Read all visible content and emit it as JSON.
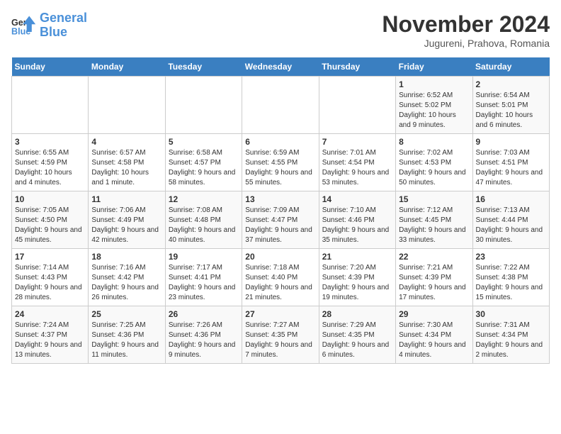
{
  "logo": {
    "line1": "General",
    "line2": "Blue"
  },
  "title": "November 2024",
  "subtitle": "Jugureni, Prahova, Romania",
  "days_of_week": [
    "Sunday",
    "Monday",
    "Tuesday",
    "Wednesday",
    "Thursday",
    "Friday",
    "Saturday"
  ],
  "weeks": [
    [
      {
        "day": "",
        "info": ""
      },
      {
        "day": "",
        "info": ""
      },
      {
        "day": "",
        "info": ""
      },
      {
        "day": "",
        "info": ""
      },
      {
        "day": "",
        "info": ""
      },
      {
        "day": "1",
        "info": "Sunrise: 6:52 AM\nSunset: 5:02 PM\nDaylight: 10 hours and 9 minutes."
      },
      {
        "day": "2",
        "info": "Sunrise: 6:54 AM\nSunset: 5:01 PM\nDaylight: 10 hours and 6 minutes."
      }
    ],
    [
      {
        "day": "3",
        "info": "Sunrise: 6:55 AM\nSunset: 4:59 PM\nDaylight: 10 hours and 4 minutes."
      },
      {
        "day": "4",
        "info": "Sunrise: 6:57 AM\nSunset: 4:58 PM\nDaylight: 10 hours and 1 minute."
      },
      {
        "day": "5",
        "info": "Sunrise: 6:58 AM\nSunset: 4:57 PM\nDaylight: 9 hours and 58 minutes."
      },
      {
        "day": "6",
        "info": "Sunrise: 6:59 AM\nSunset: 4:55 PM\nDaylight: 9 hours and 55 minutes."
      },
      {
        "day": "7",
        "info": "Sunrise: 7:01 AM\nSunset: 4:54 PM\nDaylight: 9 hours and 53 minutes."
      },
      {
        "day": "8",
        "info": "Sunrise: 7:02 AM\nSunset: 4:53 PM\nDaylight: 9 hours and 50 minutes."
      },
      {
        "day": "9",
        "info": "Sunrise: 7:03 AM\nSunset: 4:51 PM\nDaylight: 9 hours and 47 minutes."
      }
    ],
    [
      {
        "day": "10",
        "info": "Sunrise: 7:05 AM\nSunset: 4:50 PM\nDaylight: 9 hours and 45 minutes."
      },
      {
        "day": "11",
        "info": "Sunrise: 7:06 AM\nSunset: 4:49 PM\nDaylight: 9 hours and 42 minutes."
      },
      {
        "day": "12",
        "info": "Sunrise: 7:08 AM\nSunset: 4:48 PM\nDaylight: 9 hours and 40 minutes."
      },
      {
        "day": "13",
        "info": "Sunrise: 7:09 AM\nSunset: 4:47 PM\nDaylight: 9 hours and 37 minutes."
      },
      {
        "day": "14",
        "info": "Sunrise: 7:10 AM\nSunset: 4:46 PM\nDaylight: 9 hours and 35 minutes."
      },
      {
        "day": "15",
        "info": "Sunrise: 7:12 AM\nSunset: 4:45 PM\nDaylight: 9 hours and 33 minutes."
      },
      {
        "day": "16",
        "info": "Sunrise: 7:13 AM\nSunset: 4:44 PM\nDaylight: 9 hours and 30 minutes."
      }
    ],
    [
      {
        "day": "17",
        "info": "Sunrise: 7:14 AM\nSunset: 4:43 PM\nDaylight: 9 hours and 28 minutes."
      },
      {
        "day": "18",
        "info": "Sunrise: 7:16 AM\nSunset: 4:42 PM\nDaylight: 9 hours and 26 minutes."
      },
      {
        "day": "19",
        "info": "Sunrise: 7:17 AM\nSunset: 4:41 PM\nDaylight: 9 hours and 23 minutes."
      },
      {
        "day": "20",
        "info": "Sunrise: 7:18 AM\nSunset: 4:40 PM\nDaylight: 9 hours and 21 minutes."
      },
      {
        "day": "21",
        "info": "Sunrise: 7:20 AM\nSunset: 4:39 PM\nDaylight: 9 hours and 19 minutes."
      },
      {
        "day": "22",
        "info": "Sunrise: 7:21 AM\nSunset: 4:39 PM\nDaylight: 9 hours and 17 minutes."
      },
      {
        "day": "23",
        "info": "Sunrise: 7:22 AM\nSunset: 4:38 PM\nDaylight: 9 hours and 15 minutes."
      }
    ],
    [
      {
        "day": "24",
        "info": "Sunrise: 7:24 AM\nSunset: 4:37 PM\nDaylight: 9 hours and 13 minutes."
      },
      {
        "day": "25",
        "info": "Sunrise: 7:25 AM\nSunset: 4:36 PM\nDaylight: 9 hours and 11 minutes."
      },
      {
        "day": "26",
        "info": "Sunrise: 7:26 AM\nSunset: 4:36 PM\nDaylight: 9 hours and 9 minutes."
      },
      {
        "day": "27",
        "info": "Sunrise: 7:27 AM\nSunset: 4:35 PM\nDaylight: 9 hours and 7 minutes."
      },
      {
        "day": "28",
        "info": "Sunrise: 7:29 AM\nSunset: 4:35 PM\nDaylight: 9 hours and 6 minutes."
      },
      {
        "day": "29",
        "info": "Sunrise: 7:30 AM\nSunset: 4:34 PM\nDaylight: 9 hours and 4 minutes."
      },
      {
        "day": "30",
        "info": "Sunrise: 7:31 AM\nSunset: 4:34 PM\nDaylight: 9 hours and 2 minutes."
      }
    ]
  ]
}
